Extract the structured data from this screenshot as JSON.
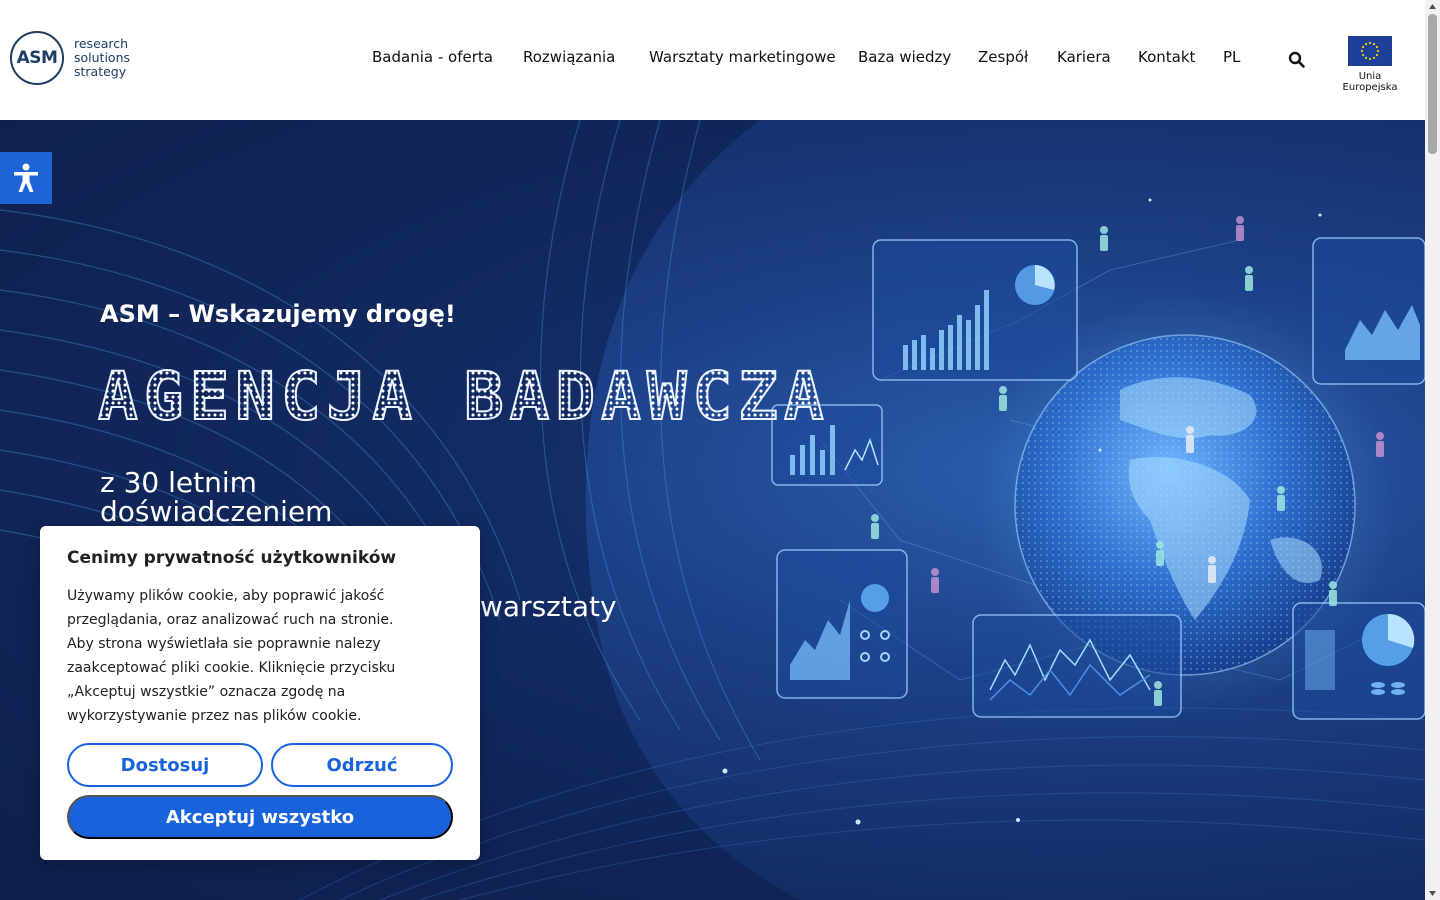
{
  "header": {
    "logo": {
      "mark": "ASM",
      "lines": [
        "research",
        "solutions",
        "strategy"
      ]
    },
    "nav": [
      {
        "label": "Badania - oferta"
      },
      {
        "label": "Rozwiązania"
      },
      {
        "label": "Warsztaty marketingowe"
      },
      {
        "label": "Baza wiedzy"
      },
      {
        "label": "Zespół"
      },
      {
        "label": "Kariera"
      },
      {
        "label": "Kontakt"
      },
      {
        "label": "PL"
      }
    ],
    "search_icon": "search-icon",
    "eu": {
      "label": "Unia Europejska",
      "flag_icon": "eu-flag-icon"
    }
  },
  "hero": {
    "tagline": "ASM – Wskazujemy drogę!",
    "title": "AGENCJA BADAWCZA",
    "subtitle": "z 30 letnim doświadczeniem",
    "subtitle_tail": "warsztaty"
  },
  "accessibility": {
    "icon": "accessibility-icon"
  },
  "cookie_banner": {
    "title": "Cenimy prywatność użytkowników",
    "text_1": "Używamy plików cookie, aby poprawić jakość przeglądania, oraz analizować ruch na stronie.",
    "text_2": "Aby strona wyświetlała sie poprawnie nalezy zaakceptować pliki cookie. Kliknięcie przycisku „Akceptuj wszystkie” oznacza zgodę na wykorzystywanie przez nas plików cookie.",
    "customize_label": "Dostosuj",
    "reject_label": "Odrzuć",
    "accept_label": "Akceptuj wszystko"
  },
  "colors": {
    "brand_navy": "#1d3d63",
    "primary_blue": "#1863dc",
    "accessibility_blue": "#1e64d6",
    "hero_dark": "#142d66",
    "hero_light": "#2a5fae"
  }
}
